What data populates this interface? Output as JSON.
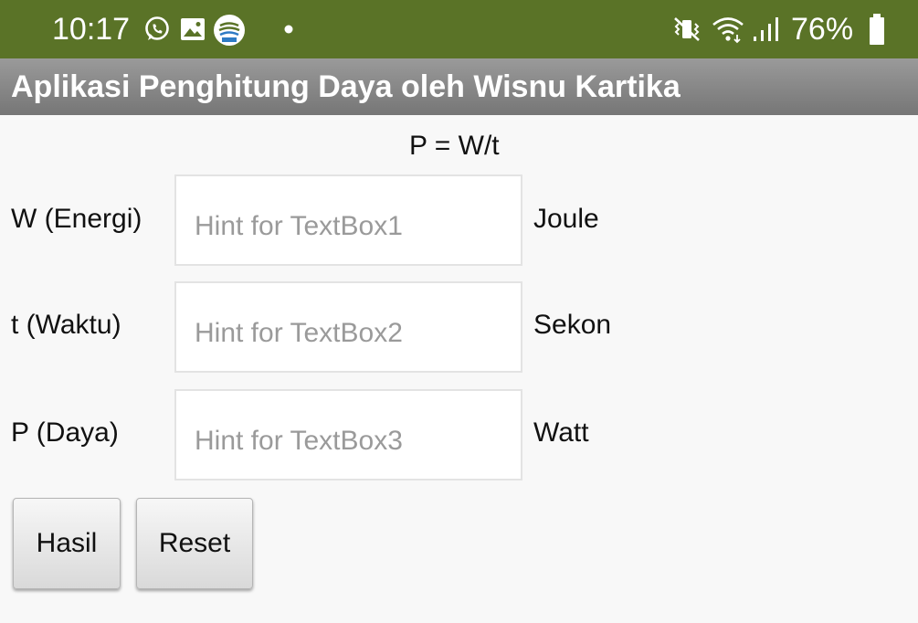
{
  "status_bar": {
    "time": "10:17",
    "battery_percent": "76%",
    "background_color": "#5a7327",
    "icons_left": [
      "whatsapp-icon",
      "gallery-icon",
      "bmkg-icon",
      "dot-icon"
    ],
    "icons_right": [
      "mute-vibrate-icon",
      "wifi-icon",
      "signal-icon",
      "battery-icon"
    ]
  },
  "app": {
    "title": "Aplikasi Penghitung Daya oleh Wisnu Kartika"
  },
  "formula": "P = W/t",
  "fields": [
    {
      "label": "W (Energi)",
      "placeholder": "Hint for TextBox1",
      "value": "",
      "unit": "Joule"
    },
    {
      "label": "t (Waktu)",
      "placeholder": "Hint for TextBox2",
      "value": "",
      "unit": "Sekon"
    },
    {
      "label": "P (Daya)",
      "placeholder": "Hint for TextBox3",
      "value": "",
      "unit": "Watt"
    }
  ],
  "buttons": {
    "hasil": "Hasil",
    "reset": "Reset"
  }
}
